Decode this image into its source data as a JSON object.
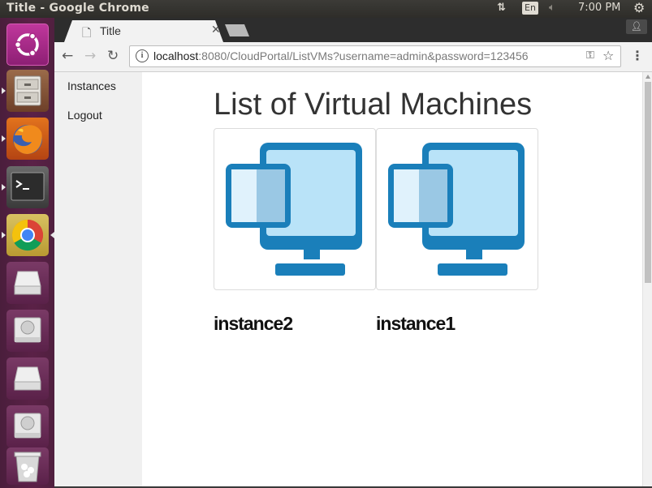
{
  "system_panel": {
    "window_title": "Title - Google Chrome",
    "network_icon": "up-down-arrows-icon",
    "keyboard_layout": "En",
    "volume_icon": "speaker-muted-icon",
    "clock": "7:00 PM",
    "settings_icon": "gear-icon"
  },
  "launcher": {
    "items": [
      {
        "name": "ubuntu-dash",
        "icon": "ubuntu-logo-icon"
      },
      {
        "name": "files",
        "icon": "file-cabinet-icon"
      },
      {
        "name": "firefox",
        "icon": "firefox-icon"
      },
      {
        "name": "terminal",
        "icon": "terminal-icon"
      },
      {
        "name": "chrome",
        "icon": "chrome-icon"
      },
      {
        "name": "drive-1",
        "icon": "drive-icon"
      },
      {
        "name": "drive-2",
        "icon": "hard-disk-icon"
      },
      {
        "name": "drive-3",
        "icon": "drive-icon"
      },
      {
        "name": "drive-4",
        "icon": "hard-disk-icon"
      },
      {
        "name": "trash",
        "icon": "trash-icon"
      }
    ]
  },
  "browser": {
    "tab_title": "Title",
    "url_host": "localhost",
    "url_rest": ":8080/CloudPortal/ListVMs?username=admin&password=123456"
  },
  "page": {
    "nav": {
      "instances": "Instances",
      "logout": "Logout"
    },
    "title": "List of Virtual Machines",
    "vms": [
      {
        "name": "instance2",
        "icon": "virtual-machine-icon"
      },
      {
        "name": "instance1",
        "icon": "virtual-machine-icon"
      }
    ]
  },
  "colors": {
    "launcher_bg": "#5b2147",
    "vm_icon_blue": "#1a7fba",
    "vm_icon_fill": "#b9e3f8"
  }
}
